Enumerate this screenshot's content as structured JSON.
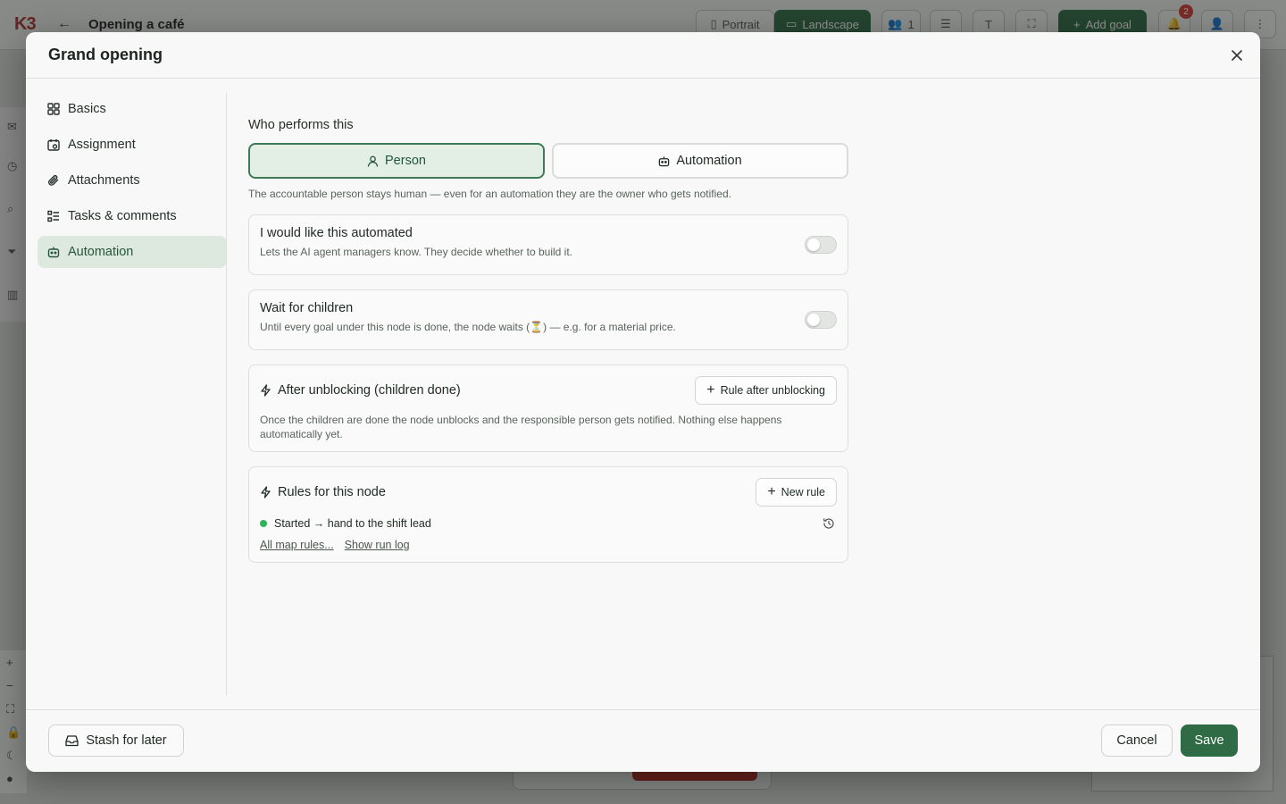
{
  "background": {
    "map_title": "Opening a café",
    "toolbar": {
      "portrait": "Portrait",
      "landscape": "Landscape",
      "members": "1",
      "add_goal": "Add goal",
      "notifications": "2"
    }
  },
  "modal": {
    "title": "Grand opening",
    "nav": [
      {
        "label": "Basics",
        "icon": "grid-icon"
      },
      {
        "label": "Assignment",
        "icon": "calendar-user-icon"
      },
      {
        "label": "Attachments",
        "icon": "paperclip-icon"
      },
      {
        "label": "Tasks & comments",
        "icon": "checklist-icon"
      },
      {
        "label": "Automation",
        "icon": "robot-icon",
        "active": true
      }
    ],
    "performer": {
      "label": "Who performs this",
      "options": [
        {
          "label": "Person",
          "icon": "person-icon",
          "selected": true
        },
        {
          "label": "Automation",
          "icon": "robot-icon",
          "selected": false
        }
      ],
      "hint": "The accountable person stays human — even for an automation they are the owner who gets notified."
    },
    "automated": {
      "title": "I would like this automated",
      "desc": "Lets the AI agent managers know. They decide whether to build it.",
      "enabled": false
    },
    "wait_children": {
      "title": "Wait for children",
      "desc": "Until every goal under this node is done, the node waits (⏳) — e.g. for a material price.",
      "enabled": false
    },
    "after_unblocking": {
      "title": "After unblocking (children done)",
      "button": "Rule after unblocking",
      "desc": "Once the children are done the node unblocks and the responsible person gets notified. Nothing else happens automatically yet."
    },
    "rules": {
      "title": "Rules for this node",
      "button": "New rule",
      "items": [
        {
          "text": "Started → hand to the shift lead",
          "status_color": "#2fb35a"
        }
      ],
      "link_all": "All map rules...",
      "link_log": "Show run log"
    },
    "footer": {
      "stash": "Stash for later",
      "cancel": "Cancel",
      "save": "Save"
    }
  },
  "colors": {
    "accent": "#2f6b45",
    "accent_light": "#dde9df",
    "status_active": "#2fb35a"
  }
}
